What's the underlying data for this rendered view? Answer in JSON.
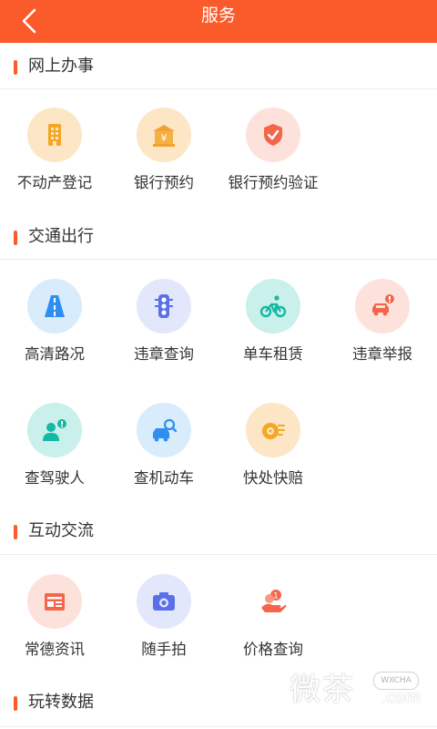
{
  "header": {
    "title": "服务",
    "back_icon": "back-chevron-icon"
  },
  "colors": {
    "accent": "#fb5a2b",
    "divider": "#ececec"
  },
  "sections": [
    {
      "title": "网上办事",
      "items": [
        {
          "label": "不动产登记",
          "icon": "building-icon"
        },
        {
          "label": "银行预约",
          "icon": "bank-yuan-icon"
        },
        {
          "label": "银行预约验证",
          "icon": "shield-check-icon"
        }
      ]
    },
    {
      "title": "交通出行",
      "items": [
        {
          "label": "高清路况",
          "icon": "road-icon"
        },
        {
          "label": "违章查询",
          "icon": "traffic-light-icon"
        },
        {
          "label": "单车租赁",
          "icon": "bicycle-icon"
        },
        {
          "label": "违章举报",
          "icon": "car-alert-icon"
        },
        {
          "label": "查驾驶人",
          "icon": "driver-alert-icon"
        },
        {
          "label": "查机动车",
          "icon": "car-search-icon"
        },
        {
          "label": "快处快赔",
          "icon": "fast-wheel-icon"
        }
      ]
    },
    {
      "title": "互动交流",
      "items": [
        {
          "label": "常德资讯",
          "icon": "news-icon"
        },
        {
          "label": "随手拍",
          "icon": "camera-icon"
        },
        {
          "label": "价格查询",
          "icon": "coin-hand-icon"
        }
      ]
    },
    {
      "title": "玩转数据",
      "items": []
    }
  ],
  "watermark": {
    "text": "微茶",
    "badge": "WXCHA",
    "suffix": ".com"
  }
}
